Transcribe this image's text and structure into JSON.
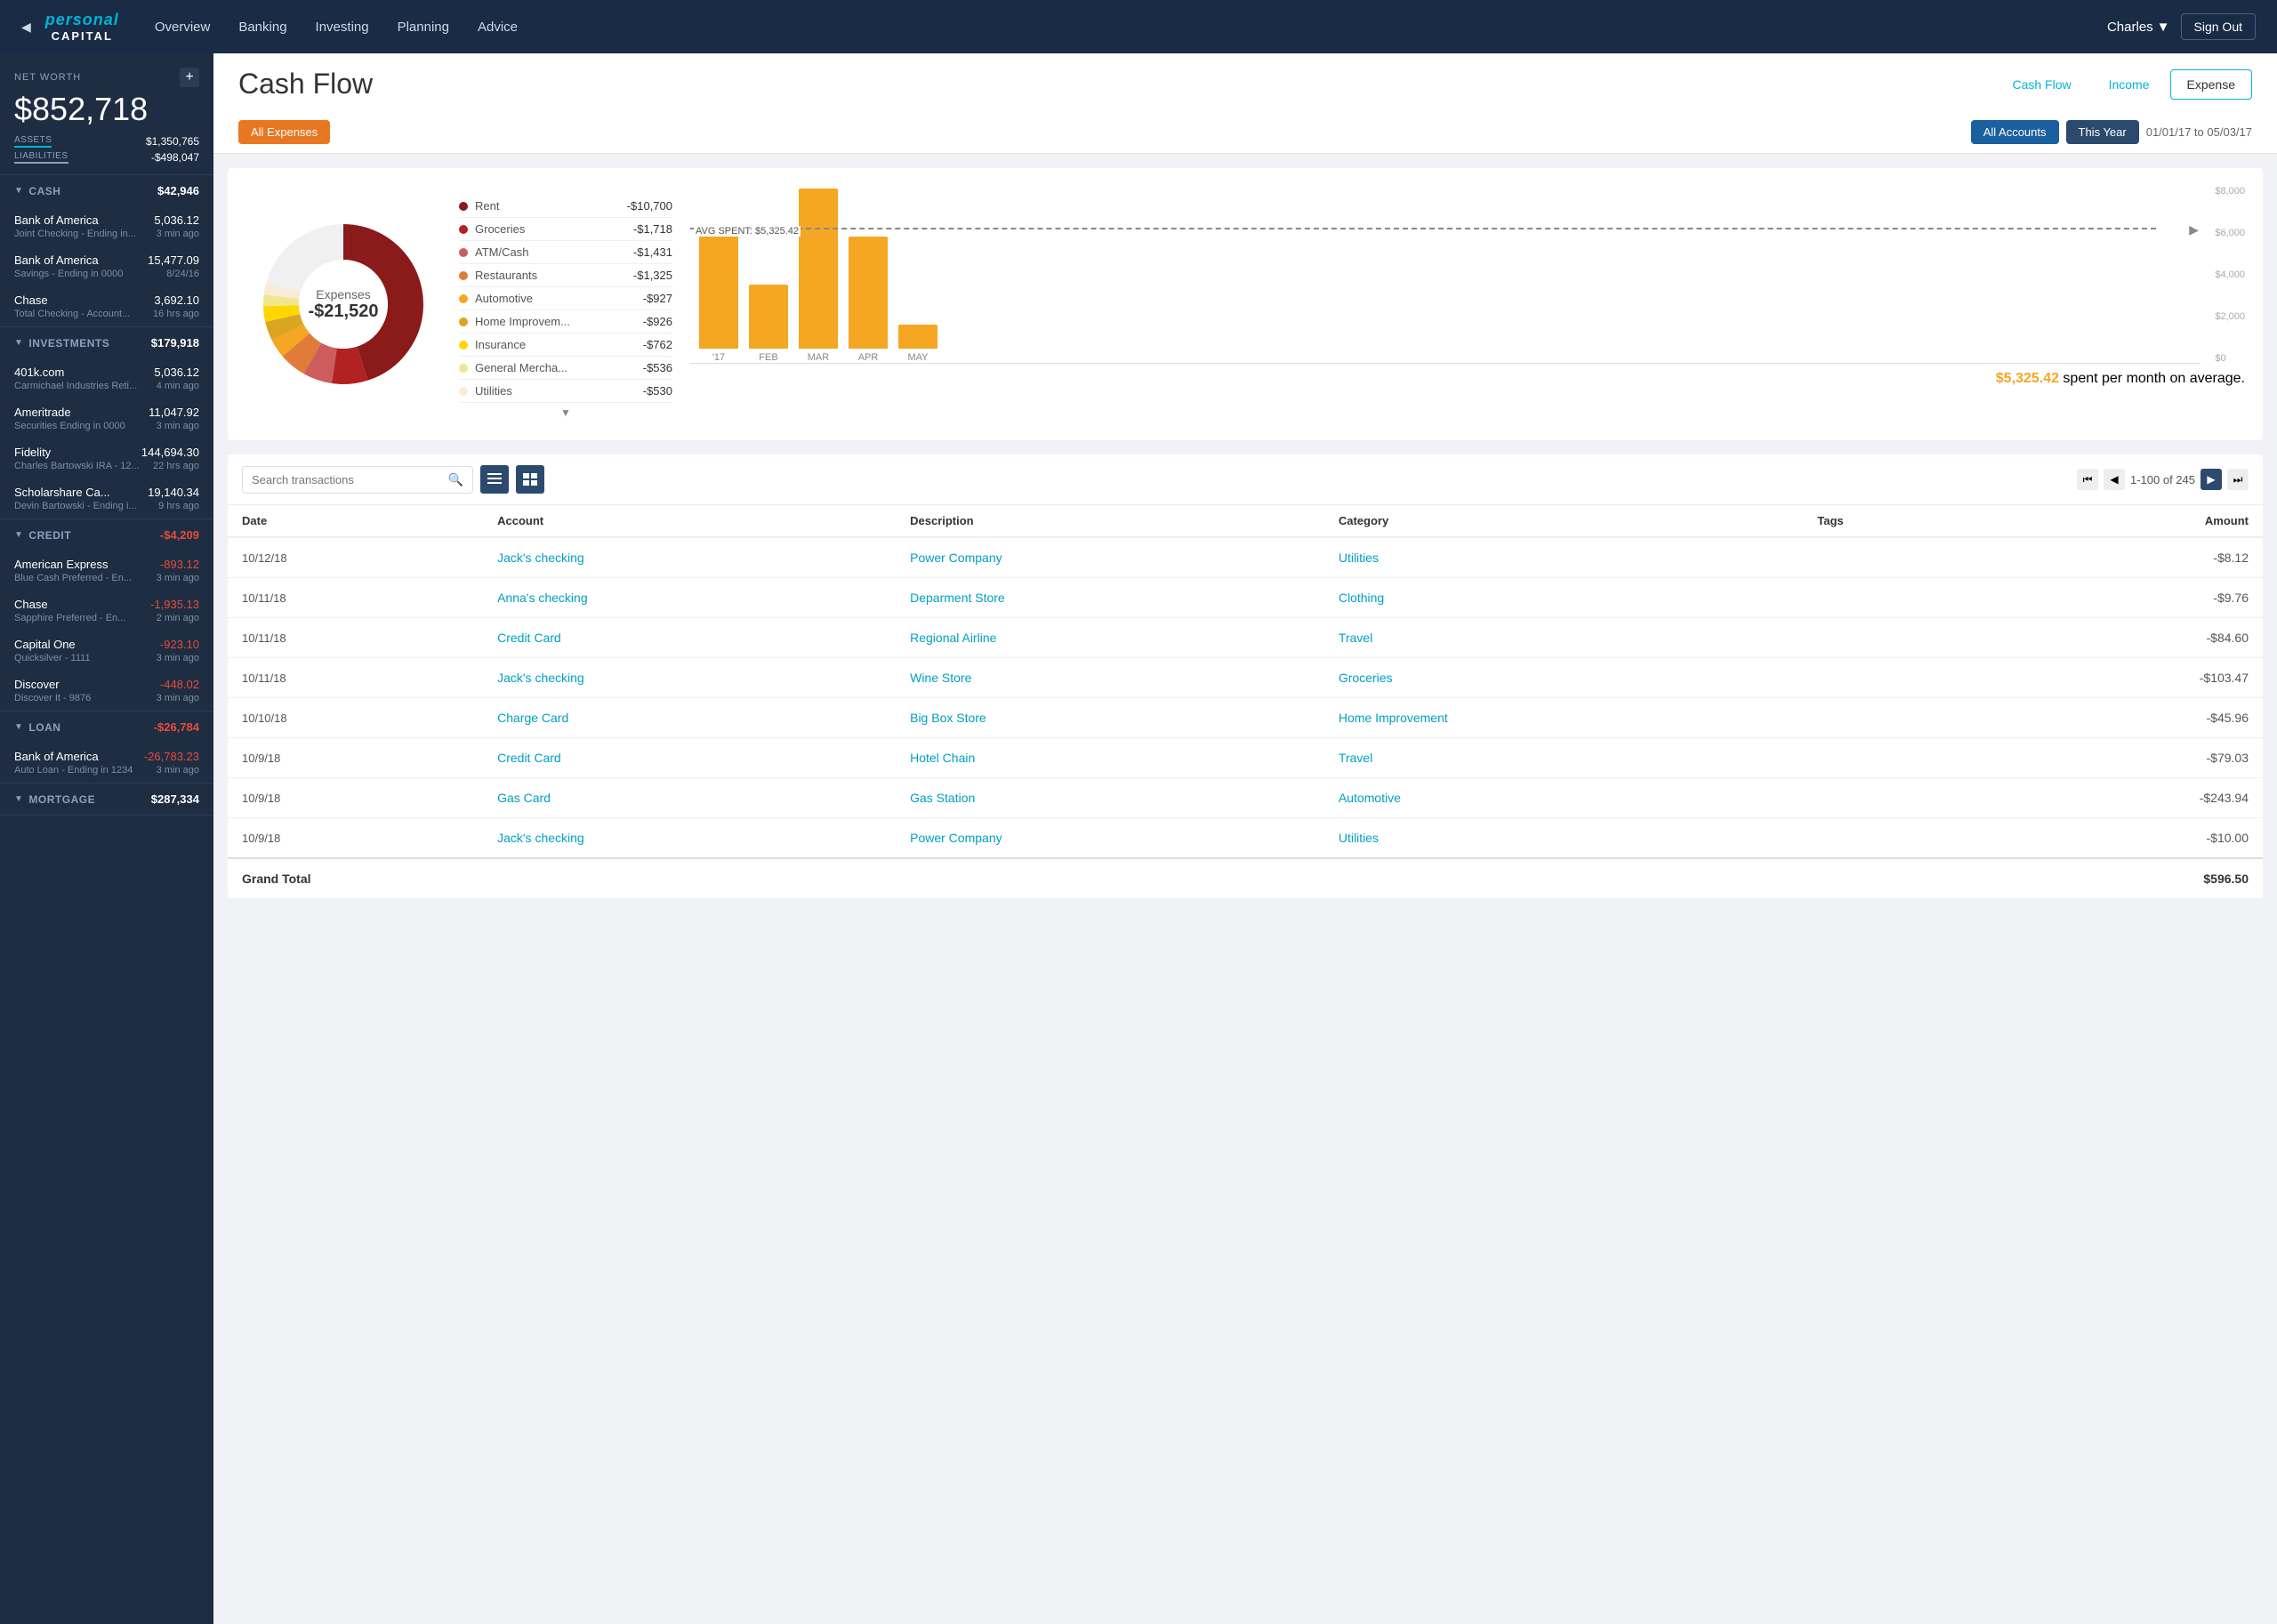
{
  "header": {
    "logo_top": "personal",
    "logo_bottom": "CAPITAL",
    "nav": [
      "Overview",
      "Banking",
      "Investing",
      "Planning",
      "Advice"
    ],
    "user": "Charles",
    "signout": "Sign Out",
    "back_arrow": "◀"
  },
  "sidebar": {
    "net_worth_label": "NET WORTH",
    "net_worth_value": "$852,718",
    "add_btn": "+",
    "assets_label": "ASSETS",
    "assets_value": "$1,350,765",
    "liabilities_label": "LIABILITIES",
    "liabilities_value": "-$498,047",
    "sections": [
      {
        "id": "cash",
        "title": "CASH",
        "total": "$42,946",
        "negative": false,
        "accounts": [
          {
            "name": "Bank of America",
            "desc": "Joint Checking - Ending in...",
            "time": "3 min ago",
            "value": "5,036.12",
            "negative": false
          },
          {
            "name": "Bank of America",
            "desc": "Savings - Ending in 0000",
            "time": "8/24/16",
            "value": "15,477.09",
            "negative": false
          },
          {
            "name": "Chase",
            "desc": "Total Checking - Account...",
            "time": "16 hrs ago",
            "value": "3,692.10",
            "negative": false
          }
        ]
      },
      {
        "id": "investments",
        "title": "INVESTMENTS",
        "total": "$179,918",
        "negative": false,
        "accounts": [
          {
            "name": "401k.com",
            "desc": "Carmichael Industries Reti...",
            "time": "4 min ago",
            "value": "5,036.12",
            "negative": false
          },
          {
            "name": "Ameritrade",
            "desc": "Securities Ending in 0000",
            "time": "3 min ago",
            "value": "11,047.92",
            "negative": false
          },
          {
            "name": "Fidelity",
            "desc": "Charles Bartowski IRA - 12...",
            "time": "22 hrs ago",
            "value": "144,694.30",
            "negative": false
          },
          {
            "name": "Scholarshare Ca...",
            "desc": "Devin Bartowski - Ending i...",
            "time": "9 hrs ago",
            "value": "19,140.34",
            "negative": false
          }
        ]
      },
      {
        "id": "credit",
        "title": "CREDIT",
        "total": "-$4,209",
        "negative": true,
        "accounts": [
          {
            "name": "American Express",
            "desc": "Blue Cash Preferred - En...",
            "time": "3 min ago",
            "value": "-893.12",
            "negative": true
          },
          {
            "name": "Chase",
            "desc": "Sapphire Preferred - En...",
            "time": "2 min ago",
            "value": "-1,935.13",
            "negative": true
          },
          {
            "name": "Capital One",
            "desc": "Quicksilver - 1111",
            "time": "3 min ago",
            "value": "-923.10",
            "negative": true
          },
          {
            "name": "Discover",
            "desc": "Discover It - 9876",
            "time": "3 min ago",
            "value": "-448.02",
            "negative": true
          }
        ]
      },
      {
        "id": "loan",
        "title": "LOAN",
        "total": "-$26,784",
        "negative": true,
        "accounts": [
          {
            "name": "Bank of America",
            "desc": "Auto Loan - Ending in 1234",
            "time": "3 min ago",
            "value": "-26,783.23",
            "negative": true
          }
        ]
      },
      {
        "id": "mortgage",
        "title": "MORTGAGE",
        "total": "$287,334",
        "negative": false,
        "accounts": []
      }
    ]
  },
  "content": {
    "page_title": "Cash Flow",
    "view_tabs": [
      "Cash Flow",
      "Income",
      "Expense"
    ],
    "active_tab": "Expense",
    "filter_all_expenses": "All Expenses",
    "filter_all_accounts": "All Accounts",
    "filter_this_year": "This Year",
    "date_range": "01/01/17  to  05/03/17",
    "donut": {
      "center_label": "Expenses",
      "center_value": "-$21,520"
    },
    "legend": [
      {
        "name": "Rent",
        "value": "-$10,700",
        "color": "#8B1A1A"
      },
      {
        "name": "Groceries",
        "value": "-$1,718",
        "color": "#B22222"
      },
      {
        "name": "ATM/Cash",
        "value": "-$1,431",
        "color": "#CD5C5C"
      },
      {
        "name": "Restaurants",
        "value": "-$1,325",
        "color": "#E07B39"
      },
      {
        "name": "Automotive",
        "value": "-$927",
        "color": "#F5A623"
      },
      {
        "name": "Home Improvem...",
        "value": "-$926",
        "color": "#DAA520"
      },
      {
        "name": "Insurance",
        "value": "-$762",
        "color": "#FFD700"
      },
      {
        "name": "General Mercha...",
        "value": "-$536",
        "color": "#F0E68C"
      },
      {
        "name": "Utilities",
        "value": "-$530",
        "color": "#FAEBD7"
      }
    ],
    "bar_chart": {
      "avg_label": "AVG SPENT",
      "avg_value": "$5,325.42",
      "avg_pct": 66,
      "bars": [
        {
          "label": "'17",
          "height_pct": 75
        },
        {
          "label": "FEB",
          "height_pct": 40
        },
        {
          "label": "MAR",
          "height_pct": 100
        },
        {
          "label": "APR",
          "height_pct": 70
        },
        {
          "label": "MAY",
          "height_pct": 15
        }
      ],
      "y_labels": [
        "$8,000",
        "$6,000",
        "$4,000",
        "$2,000",
        "$0"
      ]
    },
    "chart_footer": "$5,325.42 spent per month on average.",
    "chart_footer_value": "$5,325.42",
    "chart_footer_text": " spent per month on average.",
    "search_placeholder": "Search transactions",
    "pagination": "1-100 of 245",
    "transactions": {
      "columns": [
        "Date",
        "Account",
        "Description",
        "Category",
        "Tags",
        "Amount"
      ],
      "rows": [
        {
          "date": "10/12/18",
          "account": "Jack's checking",
          "description": "Power Company",
          "category": "Utilities",
          "tags": "",
          "amount": "-$8.12"
        },
        {
          "date": "10/11/18",
          "account": "Anna's checking",
          "description": "Deparment Store",
          "category": "Clothing",
          "tags": "",
          "amount": "-$9.76"
        },
        {
          "date": "10/11/18",
          "account": "Credit Card",
          "description": "Regional Airline",
          "category": "Travel",
          "tags": "",
          "amount": "-$84.60"
        },
        {
          "date": "10/11/18",
          "account": "Jack's checking",
          "description": "Wine Store",
          "category": "Groceries",
          "tags": "",
          "amount": "-$103.47"
        },
        {
          "date": "10/10/18",
          "account": "Charge Card",
          "description": "Big Box Store",
          "category": "Home Improvement",
          "tags": "",
          "amount": "-$45.96"
        },
        {
          "date": "10/9/18",
          "account": "Credit Card",
          "description": "Hotel Chain",
          "category": "Travel",
          "tags": "",
          "amount": "-$79.03"
        },
        {
          "date": "10/9/18",
          "account": "Gas Card",
          "description": "Gas Station",
          "category": "Automotive",
          "tags": "",
          "amount": "-$243.94"
        },
        {
          "date": "10/9/18",
          "account": "Jack's checking",
          "description": "Power Company",
          "category": "Utilities",
          "tags": "",
          "amount": "-$10.00"
        }
      ],
      "grand_total_label": "Grand Total",
      "grand_total_value": "$596.50"
    }
  }
}
